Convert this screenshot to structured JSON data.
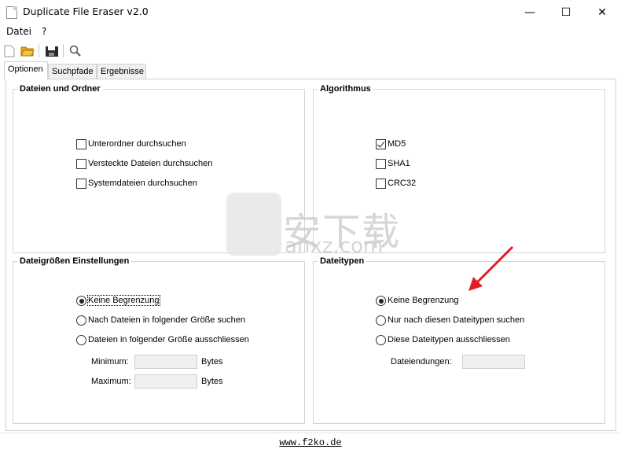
{
  "window": {
    "title": "Duplicate File Eraser v2.0",
    "minimize": "—",
    "maximize": "☐",
    "close": "✕"
  },
  "menu": [
    "Datei",
    "?"
  ],
  "toolbar": {
    "icons": [
      "new-file-icon",
      "open-folder-icon",
      "save-icon",
      "search-icon"
    ]
  },
  "tabs": [
    "Optionen",
    "Suchpfade",
    "Ergebnisse"
  ],
  "active_tab": "Optionen",
  "files_group": {
    "title": "Dateien und Ordner",
    "options": [
      {
        "label": "Unterordner durchsuchen",
        "checked": false
      },
      {
        "label": "Versteckte Dateien durchsuchen",
        "checked": false
      },
      {
        "label": "Systemdateien durchsuchen",
        "checked": false
      }
    ]
  },
  "algorithm_group": {
    "title": "Algorithmus",
    "options": [
      {
        "label": "MD5",
        "checked": true
      },
      {
        "label": "SHA1",
        "checked": false
      },
      {
        "label": "CRC32",
        "checked": false
      }
    ]
  },
  "size_group": {
    "title": "Dateigrößen Einstellungen",
    "options": [
      {
        "label": "Keine Begrenzung",
        "selected": true
      },
      {
        "label": "Nach Dateien in folgender Größe suchen",
        "selected": false
      },
      {
        "label": "Dateien in folgender Größe ausschliessen",
        "selected": false
      }
    ],
    "min_label": "Minimum:",
    "max_label": "Maximum:",
    "min_value": "",
    "max_value": "",
    "unit": "Bytes"
  },
  "types_group": {
    "title": "Dateitypen",
    "options": [
      {
        "label": "Keine Begrenzung",
        "selected": true
      },
      {
        "label": "Nur nach diesen Dateitypen suchen",
        "selected": false
      },
      {
        "label": "Diese Dateitypen ausschliessen",
        "selected": false
      }
    ],
    "ext_label": "Dateiendungen:",
    "ext_value": ""
  },
  "footer": {
    "link": "www.f2ko.de"
  },
  "watermark": {
    "text": "安下载",
    "sub": "anxz.com"
  },
  "colors": {
    "annotation_arrow": "#e02020",
    "watermark": "#cccccc"
  }
}
